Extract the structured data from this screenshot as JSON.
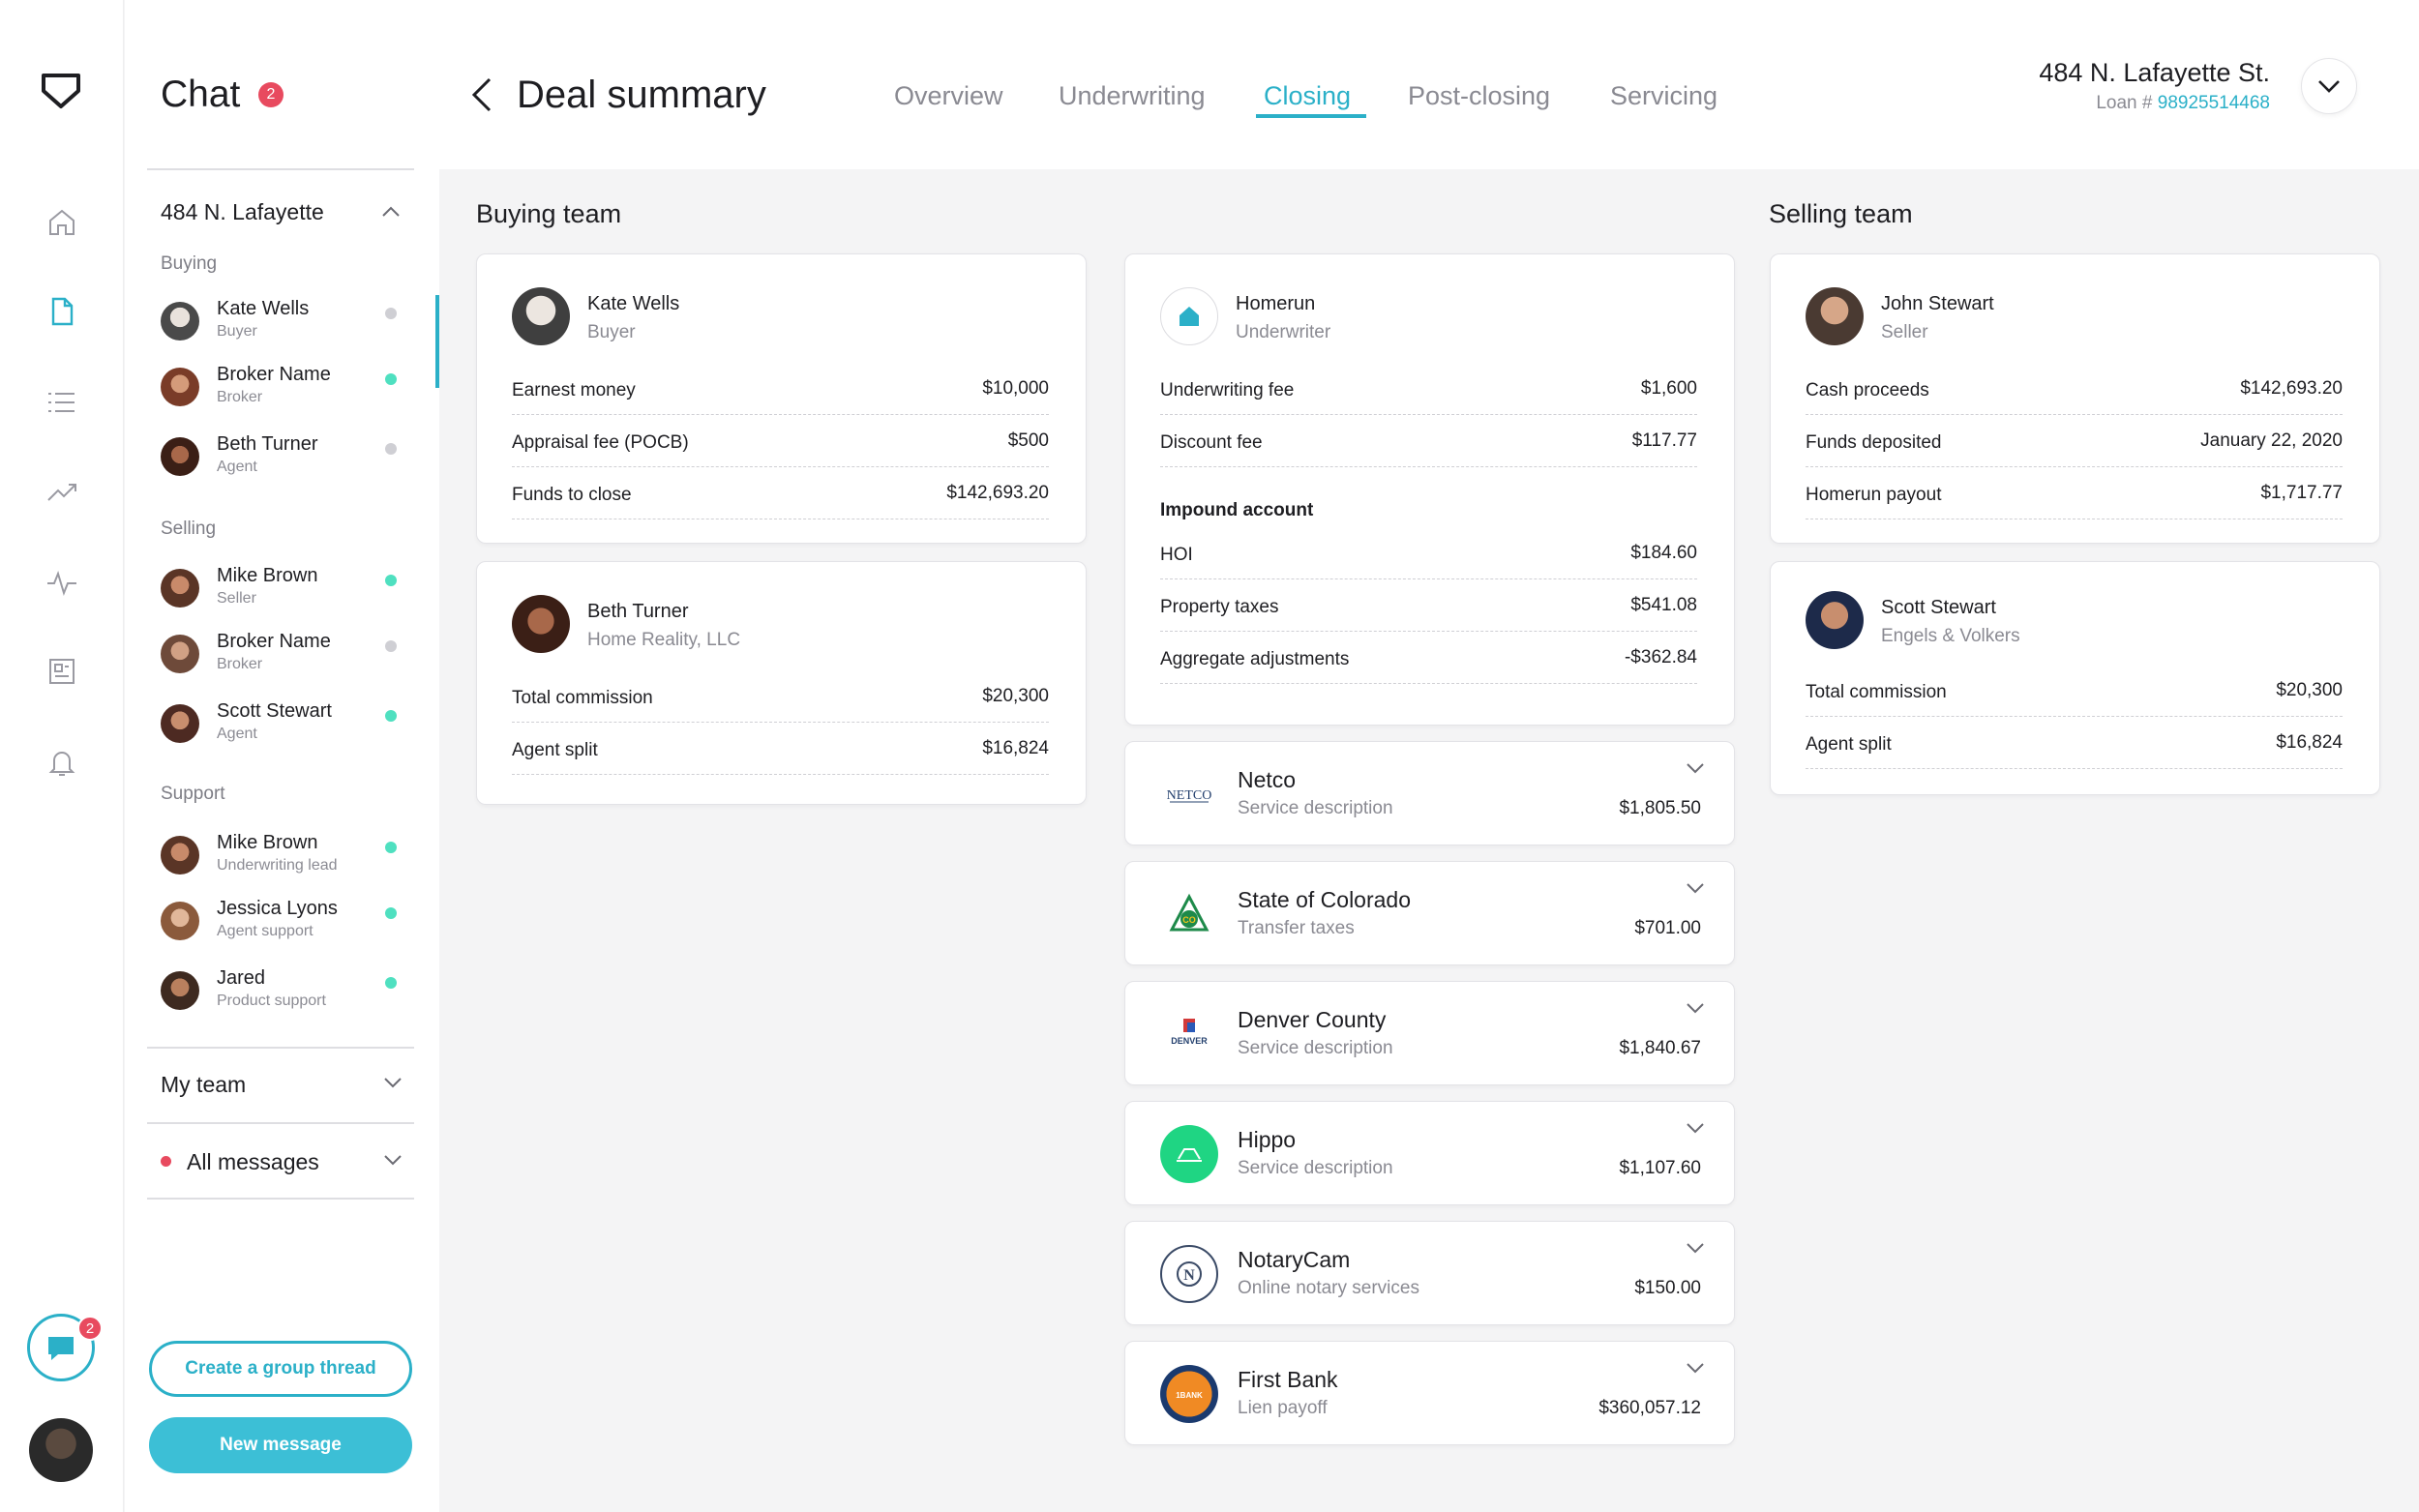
{
  "chat": {
    "title": "Chat",
    "badge": "2",
    "group": "484 N. Lafayette",
    "sections": {
      "buying": "Buying",
      "selling": "Selling",
      "support": "Support"
    },
    "contacts": [
      {
        "name": "Kate Wells",
        "role": "Buyer",
        "status": "offline"
      },
      {
        "name": "Broker Name",
        "role": "Broker",
        "status": "online"
      },
      {
        "name": "Beth Turner",
        "role": "Agent",
        "status": "offline"
      },
      {
        "name": "Mike Brown",
        "role": "Seller",
        "status": "online"
      },
      {
        "name": "Broker Name",
        "role": "Broker",
        "status": "offline"
      },
      {
        "name": "Scott Stewart",
        "role": "Agent",
        "status": "online"
      },
      {
        "name": "Mike Brown",
        "role": "Underwriting lead",
        "status": "online"
      },
      {
        "name": "Jessica Lyons",
        "role": "Agent support",
        "status": "online"
      },
      {
        "name": "Jared",
        "role": "Product support",
        "status": "online"
      }
    ],
    "my_team": "My team",
    "all_messages": "All messages",
    "create_group_label": "Create a group thread",
    "new_message_label": "New message",
    "rail_chat_badge": "2"
  },
  "header": {
    "title": "Deal summary",
    "tabs": [
      "Overview",
      "Underwriting",
      "Closing",
      "Post-closing",
      "Servicing"
    ],
    "active_tab": "Closing",
    "address": "484 N. Lafayette St.",
    "loan_label": "Loan #",
    "loan_number": "98925514468"
  },
  "buying_team": {
    "title": "Buying team",
    "cards": [
      {
        "name": "Kate Wells",
        "role": "Buyer",
        "rows": [
          {
            "label": "Earnest money",
            "value": "$10,000"
          },
          {
            "label": "Appraisal fee (POCB)",
            "value": "$500"
          },
          {
            "label": "Funds to close",
            "value": "$142,693.20"
          }
        ]
      },
      {
        "name": "Beth Turner",
        "role": "Home Reality, LLC",
        "rows": [
          {
            "label": "Total commission",
            "value": "$20,300"
          },
          {
            "label": "Agent split",
            "value": "$16,824"
          }
        ]
      }
    ]
  },
  "underwriter": {
    "name": "Homerun",
    "role": "Underwriter",
    "rows": [
      {
        "label": "Underwriting fee",
        "value": "$1,600"
      },
      {
        "label": "Discount fee",
        "value": "$117.77"
      }
    ],
    "impound_title": "Impound account",
    "impound_rows": [
      {
        "label": "HOI",
        "value": "$184.60"
      },
      {
        "label": "Property taxes",
        "value": "$541.08"
      },
      {
        "label": "Aggregate adjustments",
        "value": "-$362.84"
      }
    ]
  },
  "vendors": [
    {
      "name": "Netco",
      "desc": "Service description",
      "amount": "$1,805.50",
      "logo_text": "NETCO"
    },
    {
      "name": "State of Colorado",
      "desc": "Transfer taxes",
      "amount": "$701.00",
      "logo_text": "CO"
    },
    {
      "name": "Denver County",
      "desc": "Service description",
      "amount": "$1,840.67",
      "logo_text": "DENVER"
    },
    {
      "name": "Hippo",
      "desc": "Service description",
      "amount": "$1,107.60",
      "logo_text": ""
    },
    {
      "name": "NotaryCam",
      "desc": "Online notary services",
      "amount": "$150.00",
      "logo_text": "N"
    },
    {
      "name": "First Bank",
      "desc": "Lien payoff",
      "amount": "$360,057.12",
      "logo_text": "1BANK"
    }
  ],
  "selling_team": {
    "title": "Selling team",
    "cards": [
      {
        "name": "John Stewart",
        "role": "Seller",
        "rows": [
          {
            "label": "Cash proceeds",
            "value": "$142,693.20"
          },
          {
            "label": "Funds deposited",
            "value": "January 22, 2020"
          },
          {
            "label": "Homerun payout",
            "value": "$1,717.77"
          }
        ]
      },
      {
        "name": "Scott Stewart",
        "role": "Engels & Volkers",
        "rows": [
          {
            "label": "Total commission",
            "value": "$20,300"
          },
          {
            "label": "Agent split",
            "value": "$16,824"
          }
        ]
      }
    ]
  },
  "colors": {
    "accent": "#2bb0c8",
    "online": "#4fe0c0",
    "badge": "#e84a5f"
  }
}
